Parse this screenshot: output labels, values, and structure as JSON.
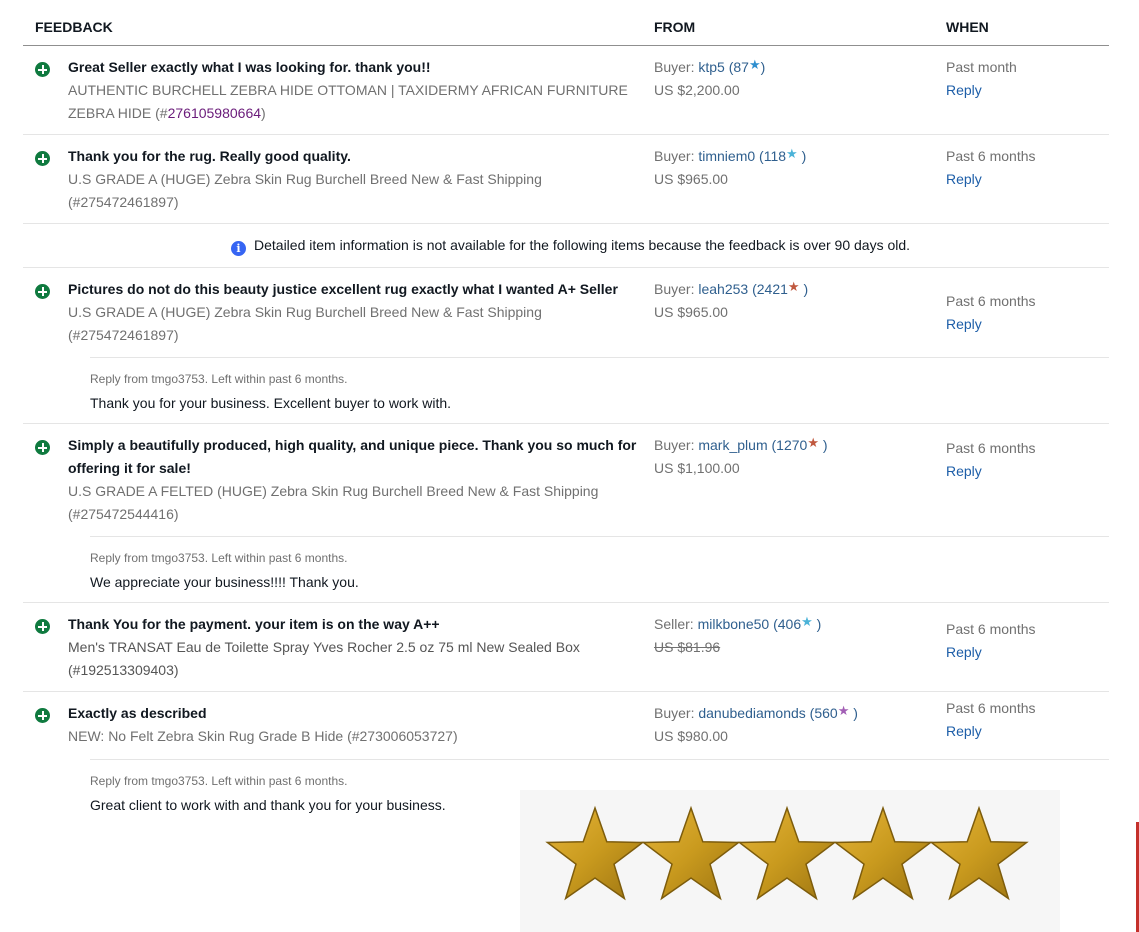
{
  "columns": {
    "feedback": "FEEDBACK",
    "from": "FROM",
    "when": "WHEN"
  },
  "entries": [
    {
      "comment": "Great Seller exactly what I was looking for. thank you!!",
      "item_line1": "AUTHENTIC BURCHELL ZEBRA HIDE OTTOMAN | TAXIDERMY AFRICAN FURNITURE",
      "item_line2_prefix": "ZEBRA HIDE (#",
      "item_number": "276105980664",
      "item_line2_suffix": ")",
      "role": "Buyer:",
      "user": "ktp5",
      "score": "87",
      "star": "★",
      "star_color": "#2f8fcf",
      "price": "US $2,200.00",
      "when": "Past month",
      "reply_label": "Reply"
    },
    {
      "comment": "Thank you for the rug. Really good quality.",
      "item_line1": "U.S GRADE A (HUGE) Zebra Skin Rug Burchell Breed New & Fast Shipping",
      "item_line2": "(#275472461897)",
      "role": "Buyer:",
      "user": "timniem0",
      "score": "118",
      "star": "★",
      "star_color": "#4bb3d8",
      "price": "US $965.00",
      "when": "Past 6 months",
      "reply_label": "Reply"
    },
    {
      "comment": "Pictures do not do this beauty justice excellent rug exactly what I wanted A+ Seller",
      "item_line1": "U.S GRADE A (HUGE) Zebra Skin Rug Burchell Breed New & Fast Shipping",
      "item_line2": "(#275472461897)",
      "role": "Buyer:",
      "user": "leah253",
      "score": "2421",
      "star": "★",
      "star_color": "#c0583e",
      "price": "US $965.00",
      "when": "Past 6 months",
      "reply_label": "Reply",
      "seller_reply_meta": "Reply from tmgo3753. Left within past 6 months.",
      "seller_reply_text": "Thank you for your business. Excellent buyer to work with."
    },
    {
      "comment_line1": "Simply a beautifully produced, high quality, and unique piece. Thank you so much for",
      "comment_line2": "offering it for sale!",
      "item_line1": "U.S GRADE A FELTED (HUGE) Zebra Skin Rug Burchell Breed New & Fast Shipping",
      "item_line2": "(#275472544416)",
      "role": "Buyer:",
      "user": "mark_plum",
      "score": "1270",
      "star": "★",
      "star_color": "#c0583e",
      "price": "US $1,100.00",
      "when": "Past 6 months",
      "reply_label": "Reply",
      "seller_reply_meta": "Reply from tmgo3753. Left within past 6 months.",
      "seller_reply_text": "We appreciate your business!!!! Thank you."
    },
    {
      "comment": "Thank You for the payment. your item is on the way A++",
      "item_line1": "Men's TRANSAT Eau de Toilette Spray Yves Rocher 2.5 oz 75 ml New Sealed Box",
      "item_line2": "(#192513309403)",
      "role": "Seller:",
      "user": "milkbone50",
      "score": "406",
      "star": "★",
      "star_color": "#4bb3d8",
      "price": "US $81.96",
      "when": "Past 6 months",
      "reply_label": "Reply"
    },
    {
      "comment": "Exactly as described",
      "item_line1": "NEW: No Felt Zebra Skin Rug Grade B Hide (#273006053727)",
      "role": "Buyer:",
      "user": "danubediamonds",
      "score": "560",
      "star": "★",
      "star_color": "#a25fb5",
      "price": "US $980.00",
      "when": "Past 6 months",
      "reply_label": "Reply",
      "seller_reply_meta": "Reply from tmgo3753. Left within past 6 months.",
      "seller_reply_text": "Great client to work with and thank you for your business."
    }
  ],
  "notice": {
    "icon": "info-icon",
    "glyph": "i",
    "text": "Detailed item information is not available for the following items because the feedback is over 90 days old."
  },
  "rating_graphic": {
    "stars": 5,
    "color": "#c99a1e"
  }
}
